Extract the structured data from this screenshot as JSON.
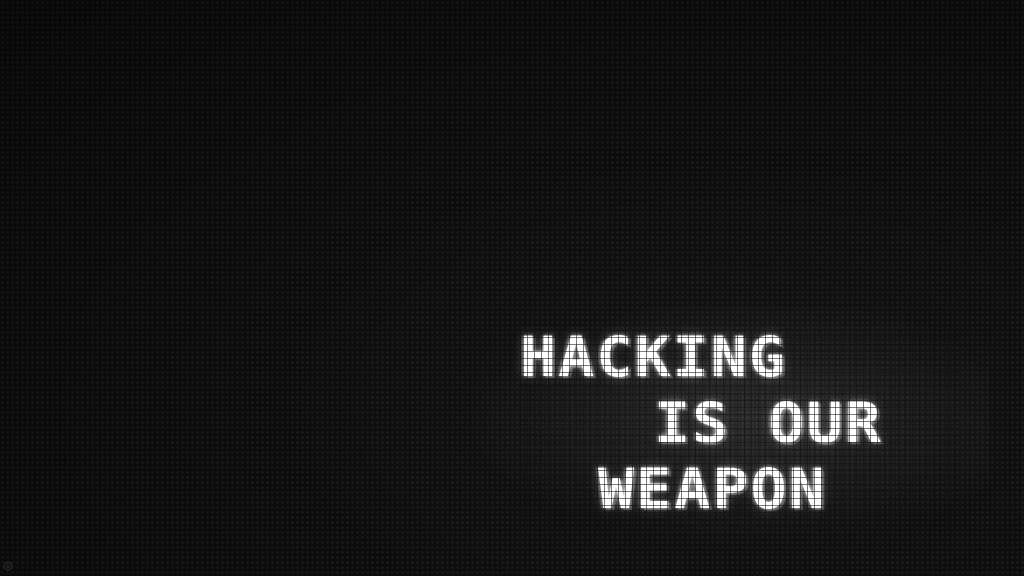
{
  "wallpaper": {
    "slogan": {
      "line_1": "HACKING",
      "line_2": "IS OUR",
      "line_3": "WEAPON"
    },
    "corner_mark": {
      "icon": "circle-logo-icon"
    },
    "colors": {
      "background": "#0c0c0c",
      "text": "#ffffff",
      "dot_grid": "#1a1a1a"
    }
  }
}
